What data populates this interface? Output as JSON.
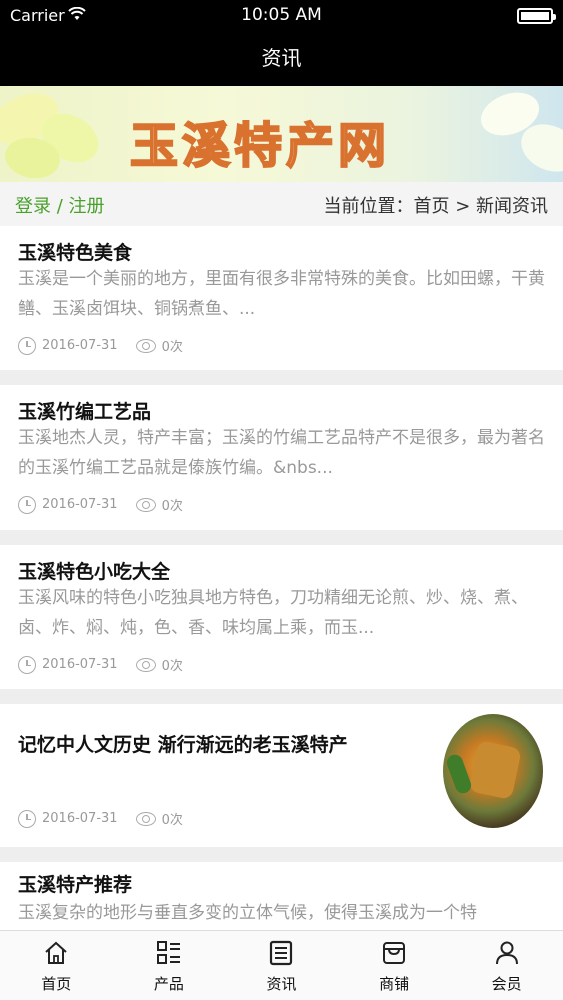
{
  "status_bar": {
    "carrier": "Carrier",
    "time": "10:05 AM"
  },
  "nav": {
    "title": "资讯"
  },
  "banner": {
    "title": "玉溪特产网"
  },
  "crumbs": {
    "login": "登录",
    "separator": "/",
    "register": "注册",
    "location": "当前位置：首页 > 新闻资讯"
  },
  "articles": [
    {
      "title": "玉溪特色美食",
      "summary": " 玉溪是一个美丽的地方，里面有很多非常特殊的美食。比如田螺，干黄鳝、玉溪卤饵块、铜锅煮鱼、...",
      "date": "2016-07-31",
      "views": "0次"
    },
    {
      "title": "玉溪竹编工艺品",
      "summary": "玉溪地杰人灵，特产丰富；玉溪的竹编工艺品特产不是很多，最为著名的玉溪竹编工艺品就是傣族竹编。&nbs...",
      "date": "2016-07-31",
      "views": "0次"
    },
    {
      "title": "玉溪特色小吃大全",
      "summary": "玉溪风味的特色小吃独具地方特色，刀功精细无论煎、炒、烧、煮、卤、炸、焖、炖，色、香、味均属上乘，而玉...",
      "date": "2016-07-31",
      "views": "0次"
    },
    {
      "title": "记忆中人文历史 渐行渐远的老玉溪特产",
      "date": "2016-07-31",
      "views": "0次"
    },
    {
      "title": "玉溪特产推荐",
      "summary": "玉溪复杂的地形与垂直多变的立体气候，使得玉溪成为一个特"
    }
  ],
  "tabbar": {
    "home": "首页",
    "products": "产品",
    "news": "资讯",
    "shops": "商铺",
    "member": "会员"
  }
}
